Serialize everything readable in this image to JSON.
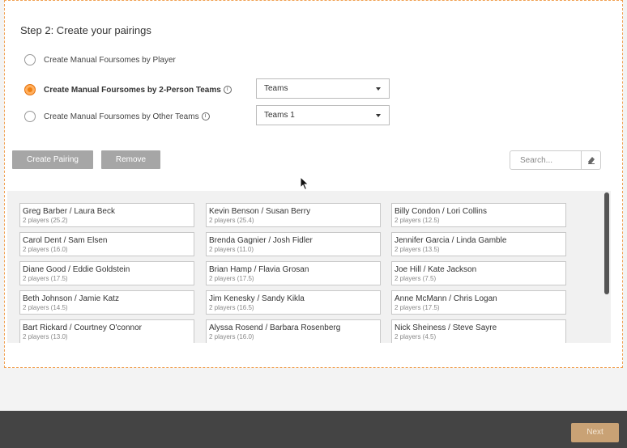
{
  "step_title": "Step 2: Create your pairings",
  "options": [
    {
      "label": "Create Manual Foursomes by Player",
      "selected": false
    },
    {
      "label": "Create Manual Foursomes by 2-Person Teams",
      "selected": true
    },
    {
      "label": "Create Manual Foursomes by Other Teams",
      "selected": false
    }
  ],
  "selects": {
    "teams": "Teams",
    "other_teams": "Teams 1"
  },
  "buttons": {
    "create_pairing": "Create Pairing",
    "remove": "Remove",
    "next": "Next"
  },
  "search": {
    "placeholder": "Search...",
    "value": ""
  },
  "info_glyph": "i",
  "colors": {
    "accent": "#f08012",
    "button_gray": "#a6a6a6",
    "footer": "#444444",
    "next_button": "#c9a275"
  },
  "teams": [
    [
      {
        "name": "Greg Barber / Laura Beck",
        "detail": "2 players (25.2)"
      },
      {
        "name": "Carol Dent / Sam Elsen",
        "detail": "2 players (16.0)"
      },
      {
        "name": "Diane Good / Eddie Goldstein",
        "detail": "2 players (17.5)"
      },
      {
        "name": "Beth Johnson / Jamie Katz",
        "detail": "2 players (14.5)"
      },
      {
        "name": "Bart Rickard / Courtney O'connor",
        "detail": "2 players (13.0)"
      }
    ],
    [
      {
        "name": "Kevin Benson / Susan Berry",
        "detail": "2 players (25.4)"
      },
      {
        "name": "Brenda Gagnier / Josh Fidler",
        "detail": "2 players (11.0)"
      },
      {
        "name": "Brian Hamp / Flavia Grosan",
        "detail": "2 players (17.5)"
      },
      {
        "name": "Jim Kenesky / Sandy Kikla",
        "detail": "2 players (16.5)"
      },
      {
        "name": "Alyssa Rosend / Barbara Rosenberg",
        "detail": "2 players (16.0)"
      }
    ],
    [
      {
        "name": "Billy Condon / Lori Collins",
        "detail": "2 players (12.5)"
      },
      {
        "name": "Jennifer Garcia / Linda Gamble",
        "detail": "2 players (13.5)"
      },
      {
        "name": "Joe Hill / Kate Jackson",
        "detail": "2 players (7.5)"
      },
      {
        "name": "Anne McMann / Chris Logan",
        "detail": "2 players (17.5)"
      },
      {
        "name": "Nick Sheiness / Steve Sayre",
        "detail": "2 players (4.5)"
      }
    ]
  ]
}
